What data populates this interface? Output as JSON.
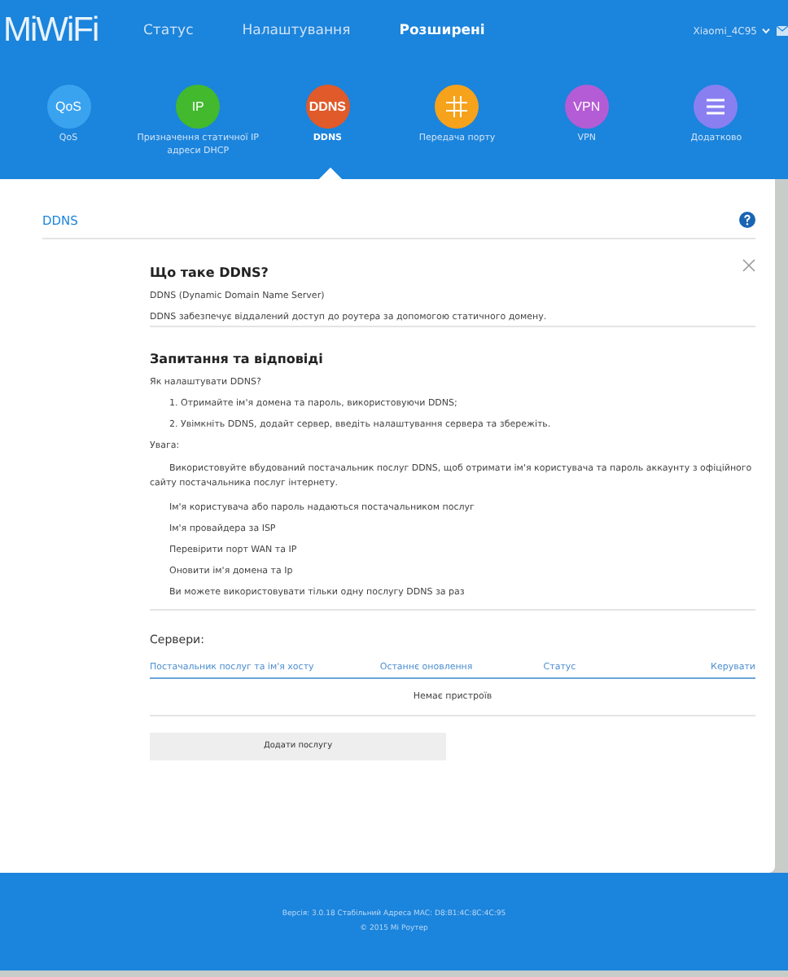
{
  "header": {
    "logo": "MiWiFi",
    "nav": [
      {
        "label": "Статус",
        "selected": false
      },
      {
        "label": "Налаштування",
        "selected": false
      },
      {
        "label": "Розширені",
        "selected": true
      }
    ],
    "router_name": "Xiaomi_4C95"
  },
  "features": [
    {
      "label": "QoS",
      "icon_text": "QoS",
      "color": "#3aa3f0",
      "selected": false
    },
    {
      "label": "Призначення статичної IP адреси DHCP",
      "icon_text": "IP",
      "color": "#43b92e",
      "selected": false
    },
    {
      "label": "DDNS",
      "icon_text": "DDNS",
      "color": "#e05a2a",
      "selected": true
    },
    {
      "label": "Передача порту",
      "color": "#f7a21b",
      "selected": false
    },
    {
      "label": "VPN",
      "icon_text": "VPN",
      "color": "#b45cd6",
      "selected": false
    },
    {
      "label": "Додатково",
      "color": "#8a7ff0",
      "selected": false
    }
  ],
  "section_title": "DDNS",
  "help": {
    "title": "Що таке DDNS?",
    "lines": [
      "DDNS (Dynamic Domain Name Server)",
      "DDNS забезпечує віддалений доступ до роутера за допомогою статичного домену."
    ],
    "faq_title": "Запитання та відповіді",
    "question": "Як налаштувати DDNS?",
    "steps": [
      "1. Отримайте ім'я домена та пароль, використовуючи DDNS;",
      "2. Увімкніть DDNS, додайт сервер, введіть налаштування сервера та збережіть."
    ],
    "note_label": "Увага:",
    "note_text": "Використовуйте вбудований постачальник послуг DDNS, щоб отримати ім'я користувача та пароль аккаунту з офіційного сайту постачальника послуг інтернету.",
    "notes": [
      "Ім'я користувача або пароль надаються постачальником послуг",
      "Ім'я провайдера за ISP",
      "Перевірити порт WAN та IP",
      "Оновити ім'я домена та Ip",
      "Ви можете використовувати тільки одну послугу DDNS за раз"
    ]
  },
  "servers": {
    "title": "Сервери:",
    "columns": [
      "Постачальник послуг та ім'я хосту",
      "Останнє оновлення",
      "Статус",
      "Керувати"
    ],
    "empty": "Немає пристроїв",
    "add_button": "Додати послугу"
  },
  "footer": {
    "version": "Версія: 3.0.18 Стабільний  Адреса MAC: D8:B1:4C:8C:4C:95",
    "copyright": "© 2015 Mi Роутер"
  }
}
